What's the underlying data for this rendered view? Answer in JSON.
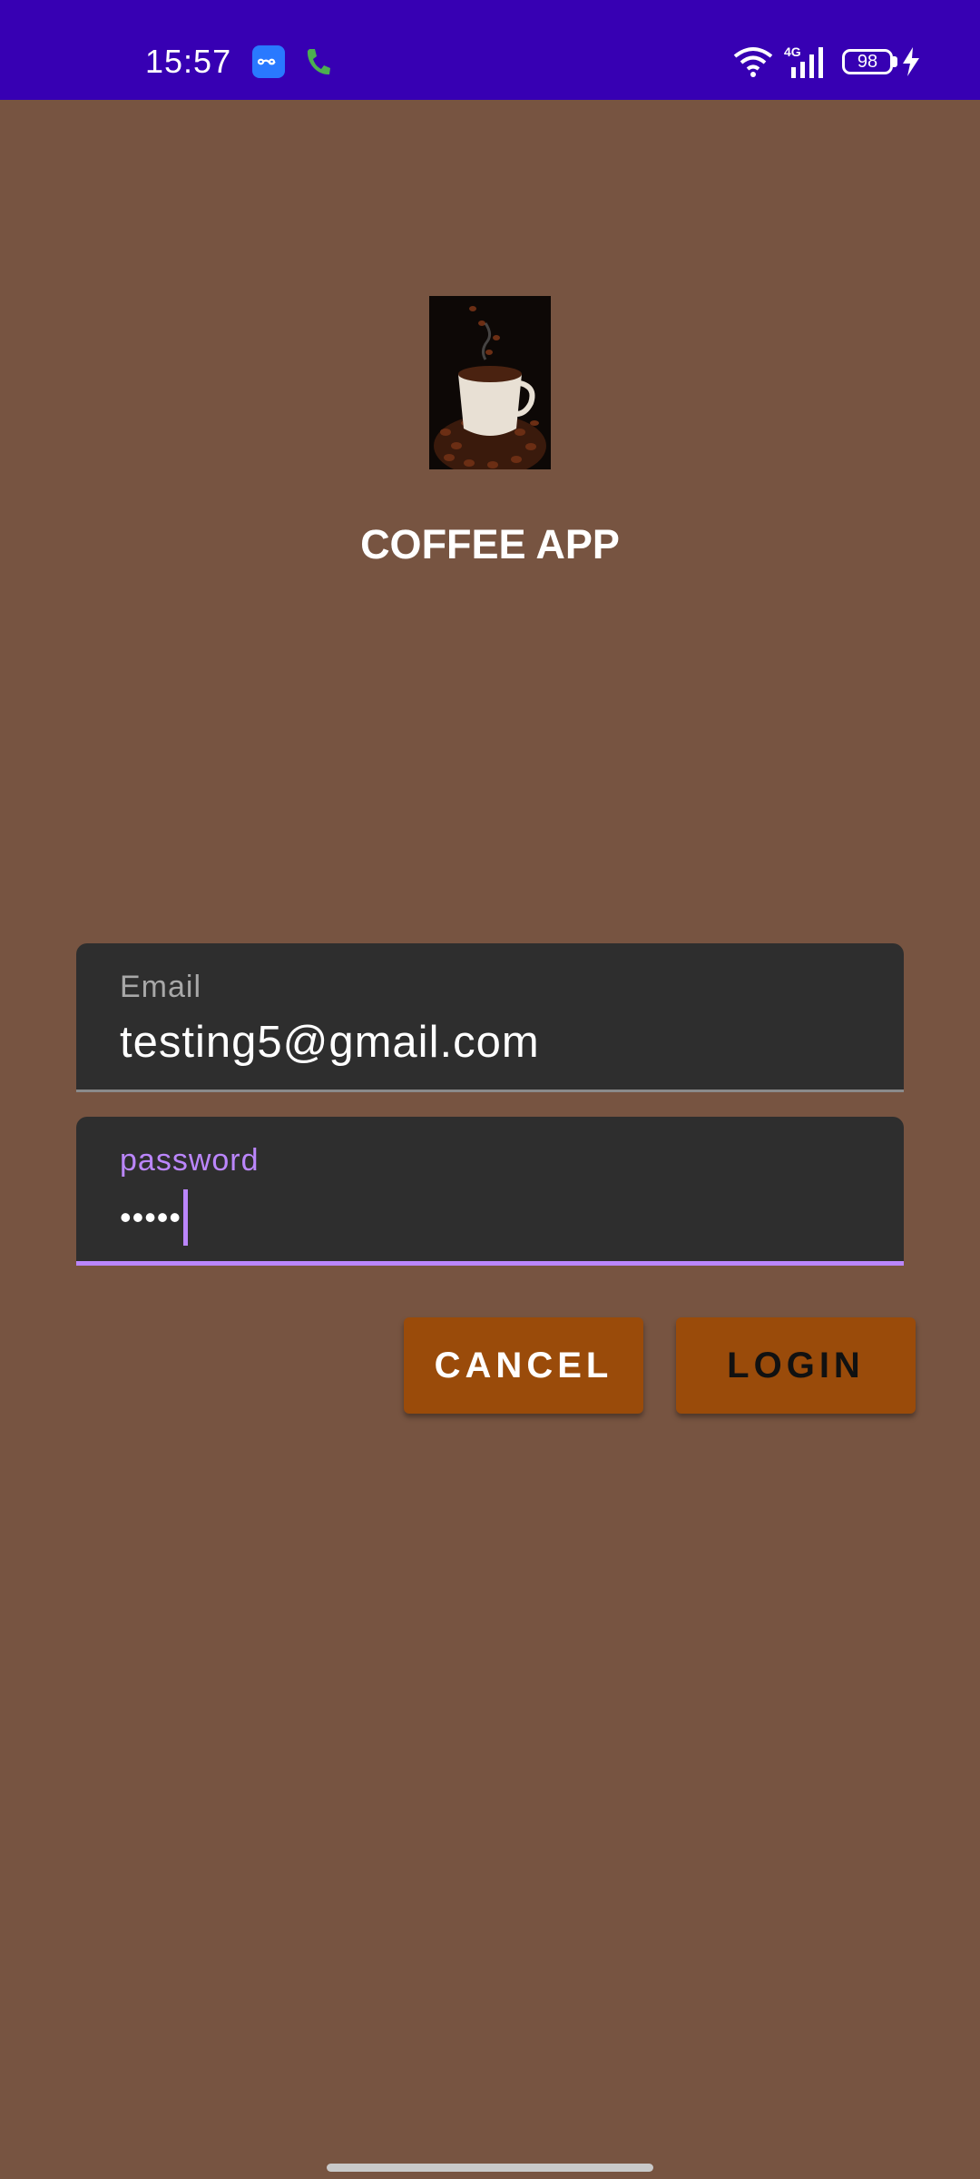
{
  "status_bar": {
    "time": "15:57",
    "network": "4G",
    "battery": "98",
    "background": "#3700b3"
  },
  "app": {
    "title": "COFFEE APP",
    "logo_icon": "coffee-cup-image",
    "background": "#775441"
  },
  "form": {
    "email": {
      "label": "Email",
      "value": "testing5@gmail.com"
    },
    "password": {
      "label": "password",
      "masked_value": "•••••"
    },
    "accent": "#bb86fc"
  },
  "buttons": {
    "cancel": "CANCEL",
    "login": "LOGIN",
    "color": "#9a4b0a"
  }
}
